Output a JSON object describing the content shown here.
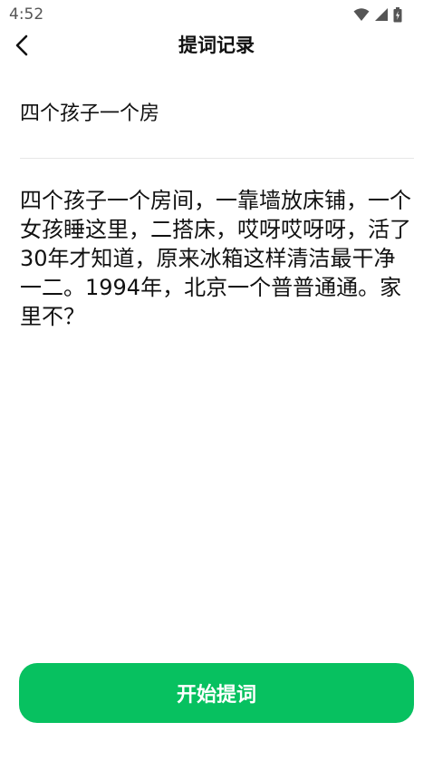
{
  "status_bar": {
    "time": "4:52",
    "icons": [
      "wifi-icon",
      "signal-icon",
      "battery-icon"
    ]
  },
  "header": {
    "title": "提词记录",
    "back_icon": "chevron-left-icon"
  },
  "record": {
    "title": "四个孩子一个房",
    "content": "四个孩子一个房间，一靠墙放床铺，一个女孩睡这里，二搭床，哎呀哎呀呀，活了30年才知道，原来冰箱这样清洁最干净一二。1994年，北京一个普普通通。家里不？"
  },
  "actions": {
    "start_label": "开始提词"
  },
  "colors": {
    "accent": "#07c160",
    "text": "#111111",
    "divider": "#e6e6e6"
  }
}
